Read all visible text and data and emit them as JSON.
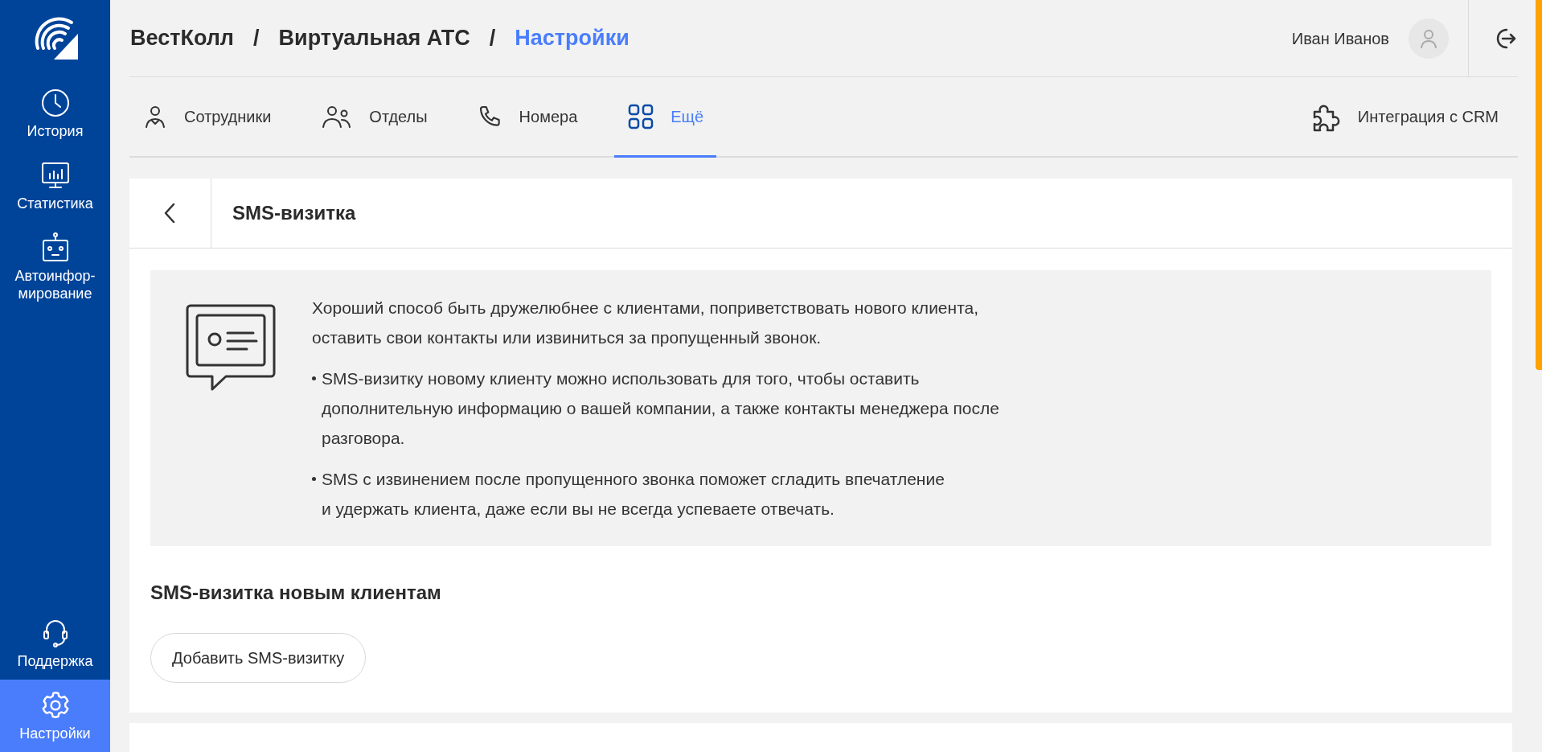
{
  "sidebar": {
    "items": [
      {
        "kind": "history",
        "label": "История",
        "selected": false
      },
      {
        "kind": "stats",
        "label": "Статистика",
        "selected": false
      },
      {
        "kind": "robot",
        "label": "Автоинфор-\nмирование",
        "selected": false
      }
    ],
    "bottom_items": [
      {
        "kind": "support",
        "label": "Поддержка",
        "selected": false
      },
      {
        "kind": "settings",
        "label": "Настройки",
        "selected": true
      }
    ]
  },
  "breadcrumbs": [
    {
      "label": "ВестКолл",
      "selected": false
    },
    {
      "label": "Виртуальная АТС",
      "selected": false
    },
    {
      "label": "Настройки",
      "selected": true
    }
  ],
  "breadcrumb_separators": [
    "/",
    "/"
  ],
  "user": {
    "name": "Иван Иванов"
  },
  "tabs": [
    {
      "kind": "person",
      "label": "Сотрудники",
      "selected": false
    },
    {
      "kind": "group",
      "label": "Отделы",
      "selected": false
    },
    {
      "kind": "phone",
      "label": "Номера",
      "selected": false
    },
    {
      "kind": "grid",
      "label": "Ещё",
      "selected": true
    }
  ],
  "crm_link": {
    "label": "Интеграция с CRM"
  },
  "page": {
    "title": "SMS-визитка",
    "info": {
      "intro": "Хороший способ быть дружелюбнее с клиентами, поприветствовать нового клиента,\nоставить свои контакты или извиниться за пропущенный звонок.",
      "bullets": [
        "SMS-визитку новому клиенту можно использовать для того, чтобы оставить\nдополнительную информацию о вашей компании, а также контакты менеджера после\nразговора.",
        "SMS с извинением после пропущенного звонка поможет сгладить впечатление\nи удержать клиента, даже если вы не всегда успеваете отвечать."
      ]
    },
    "section_title": "SMS-визитка новым клиентам",
    "add_button": "Добавить SMS-визитку"
  }
}
